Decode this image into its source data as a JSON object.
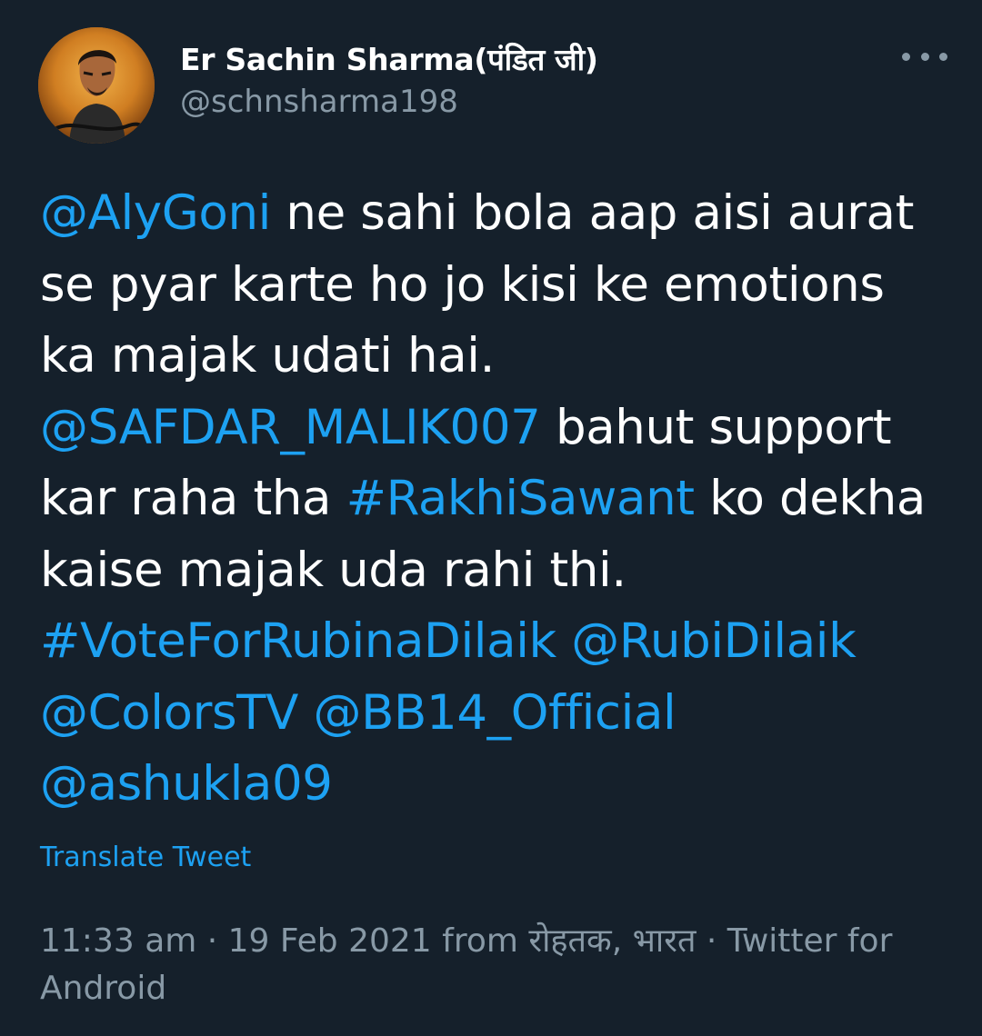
{
  "author": {
    "display_name": "Er Sachin Sharma(पंडित जी)",
    "handle": "@schnsharma198"
  },
  "icons": {
    "more": "more-options-icon"
  },
  "colors": {
    "background": "#15202b",
    "text": "#ffffff",
    "link": "#1da1f2",
    "muted": "#8899a6"
  },
  "tweet": {
    "line1_link": "@AlyGoni",
    "line1_text": " ne sahi bola aap aisi aurat",
    "line2_text": "se pyar karte ho jo kisi ke emotions",
    "line3_text": "ka majak udati hai.",
    "line4_link": "@SAFDAR_MALIK007",
    "line4_text": " bahut support",
    "line5_text_a": "kar raha tha ",
    "line5_link": "#RakhiSawant",
    "line5_text_b": " ko dekha",
    "line6_text": "kaise majak uda rahi thi.",
    "line7_hashtag": "#VoteForRubinaDilaik",
    "line7_mention": "@RubiDilaik",
    "line8_mention_a": "@ColorsTV",
    "line8_mention_b": "@BB14_Official",
    "line9_mention": "@ashukla09"
  },
  "translate_label": "Translate Tweet",
  "meta": {
    "line1": "11:33 am · 19 Feb 2021 from रोहतक, भारत · Twitter for",
    "line2": "Android"
  }
}
